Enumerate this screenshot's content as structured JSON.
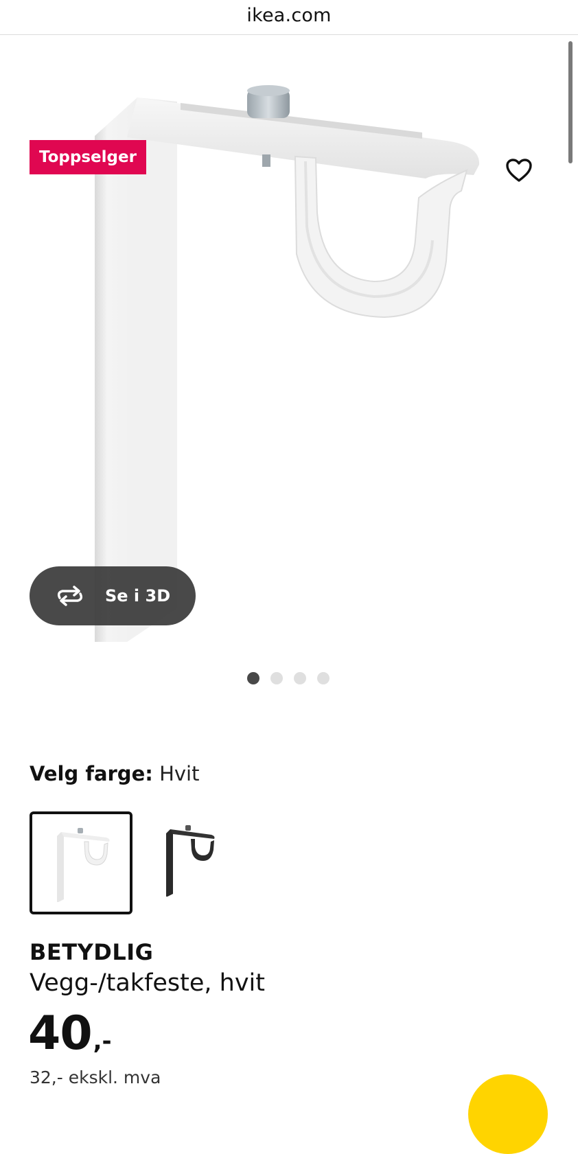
{
  "browser": {
    "url": "ikea.com"
  },
  "gallery": {
    "badge": "Toppselger",
    "view_3d_label": "Se i 3D",
    "slide_count": 4,
    "active_slide": 1
  },
  "color_picker": {
    "label": "Velg farge:",
    "selected_value": "Hvit",
    "options": [
      "white-bracket",
      "black-bracket"
    ]
  },
  "product": {
    "name": "BETYDLIG",
    "description": "Vegg-/takfeste, hvit",
    "price_main": "40",
    "price_suffix": ",-",
    "price_excl_vat": "32,- ekskl. mva"
  },
  "colors": {
    "badge_bg": "#e00751",
    "cart_button": "#ffd400",
    "dot_active": "#484848",
    "dot_inactive": "#dfdfdf"
  },
  "icons": {
    "favorite": "heart-outline-icon",
    "view_3d": "rotate-arrows-icon"
  }
}
